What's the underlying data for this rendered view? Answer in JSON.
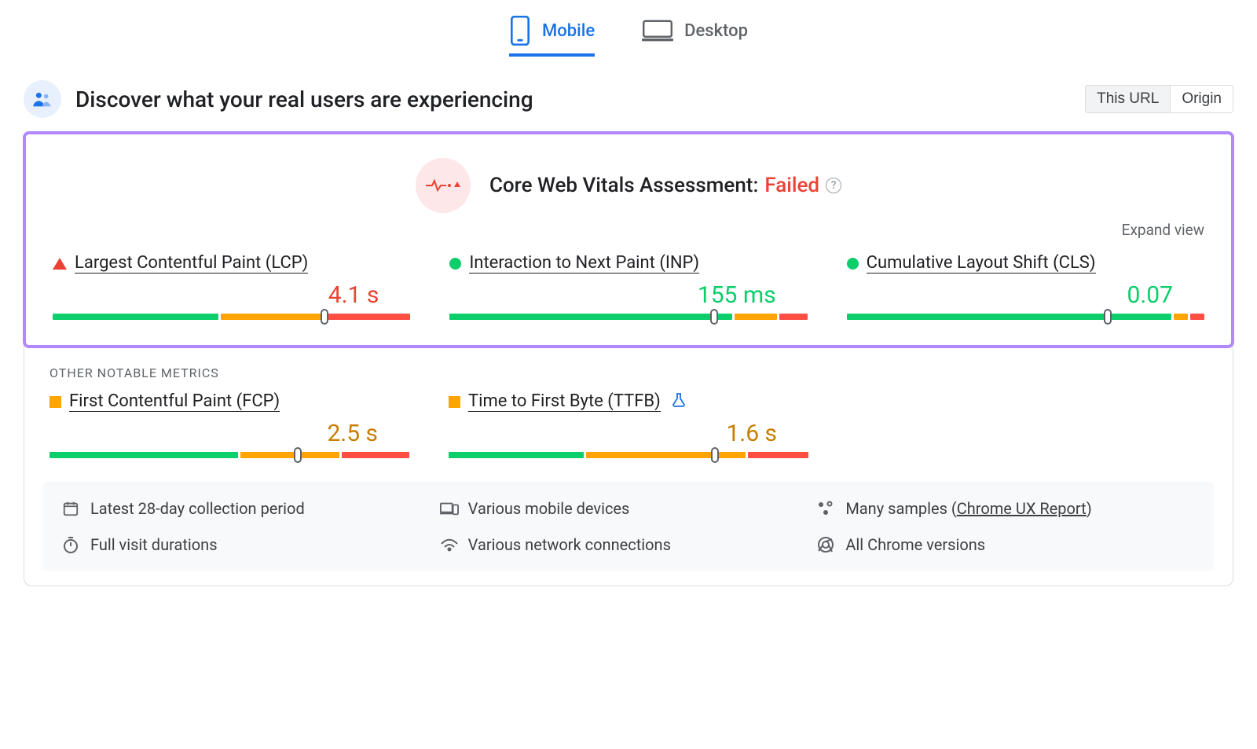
{
  "tabs": {
    "mobile": "Mobile",
    "desktop": "Desktop",
    "active": "mobile"
  },
  "header": {
    "title": "Discover what your real users are experiencing",
    "scope_url": "This URL",
    "scope_origin": "Origin"
  },
  "assessment": {
    "label": "Core Web Vitals Assessment:",
    "status": "Failed",
    "expand": "Expand view"
  },
  "metrics": {
    "lcp": {
      "name": "Largest Contentful Paint (LCP)",
      "value": "4.1 s",
      "indicator": "poor",
      "segments": [
        47,
        29,
        24
      ],
      "thumb": 76
    },
    "inp": {
      "name": "Interaction to Next Paint (INP)",
      "value": "155 ms",
      "indicator": "good",
      "segments": [
        80,
        12,
        8
      ],
      "thumb": 74
    },
    "cls": {
      "name": "Cumulative Layout Shift (CLS)",
      "value": "0.07",
      "indicator": "good",
      "segments": [
        92,
        4,
        4
      ],
      "thumb": 73
    }
  },
  "other_heading": "OTHER NOTABLE METRICS",
  "other": {
    "fcp": {
      "name": "First Contentful Paint (FCP)",
      "value": "2.5 s",
      "indicator": "average",
      "segments": [
        53,
        28,
        19
      ],
      "thumb": 69
    },
    "ttfb": {
      "name": "Time to First Byte (TTFB)",
      "value": "1.6 s",
      "indicator": "average",
      "segments": [
        38,
        45,
        17
      ],
      "thumb": 74,
      "experimental": true
    }
  },
  "footer": {
    "period": "Latest 28-day collection period",
    "devices": "Various mobile devices",
    "samples_prefix": "Many samples (",
    "samples_link": "Chrome UX Report",
    "samples_suffix": ")",
    "durations": "Full visit durations",
    "network": "Various network connections",
    "versions": "All Chrome versions"
  }
}
